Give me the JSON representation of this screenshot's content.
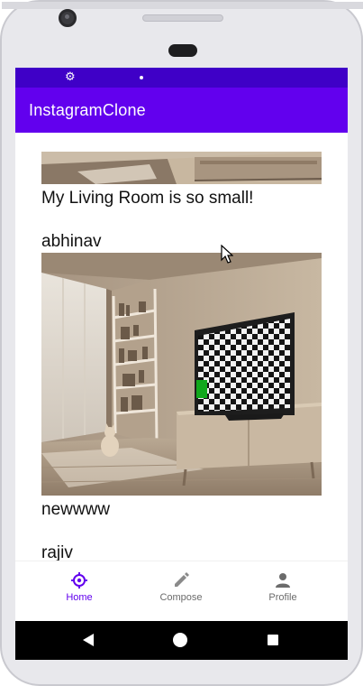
{
  "app": {
    "title": "InstagramClone"
  },
  "status_bar": {
    "icons": [
      "gear-icon",
      "dot-icon"
    ],
    "color": "#3f00c7"
  },
  "theme": {
    "primary": "#6200ee",
    "primary_dark": "#3f00c7",
    "nav_active": "#6200ee",
    "nav_inactive": "#6b6b6b"
  },
  "feed": {
    "posts": [
      {
        "username": "",
        "image": "living-room-photo-cropped",
        "caption": "My Living Room is so small!"
      },
      {
        "username": "abhinav",
        "image": "living-room-photo-with-tv",
        "caption": "newwww"
      },
      {
        "username": "rajiv",
        "image": "",
        "caption": ""
      }
    ]
  },
  "bottom_nav": {
    "items": [
      {
        "label": "Home",
        "icon": "home-crosshair-icon",
        "active": true
      },
      {
        "label": "Compose",
        "icon": "pencil-icon",
        "active": false
      },
      {
        "label": "Profile",
        "icon": "person-icon",
        "active": false
      }
    ]
  },
  "system_nav": {
    "buttons": [
      "back-icon",
      "home-circle-icon",
      "recents-square-icon"
    ]
  }
}
